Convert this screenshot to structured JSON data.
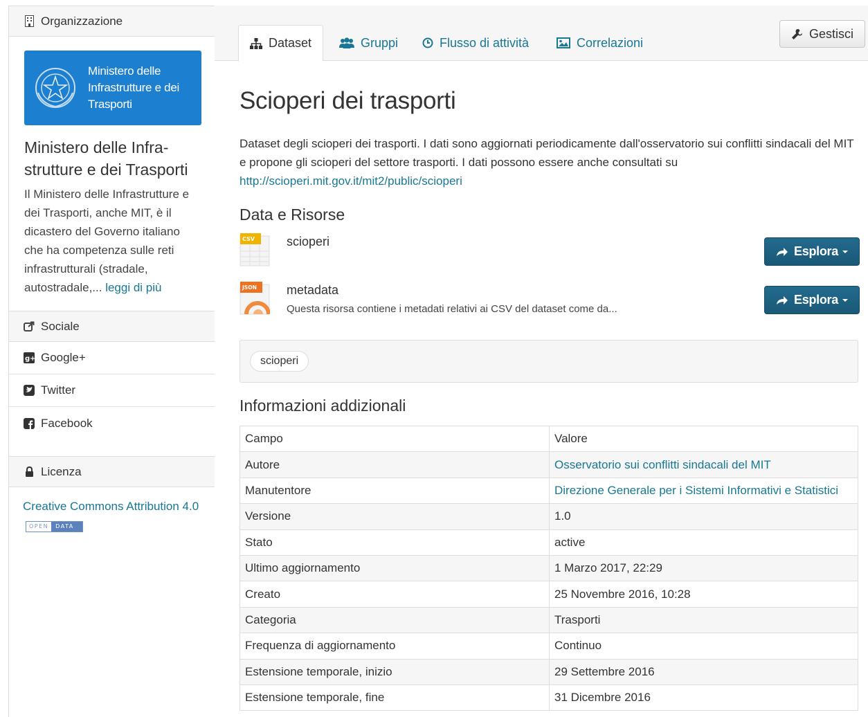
{
  "sidebar": {
    "org_heading": "Organizzazione",
    "logo_text": [
      "Ministero delle",
      "Infrastrutture e dei",
      "Trasporti"
    ],
    "org_title_line1": "Ministero delle Infra-",
    "org_title_line2": "strutture e dei Trasporti",
    "org_description": "Il Ministero delle Infrastrutture e dei Trasporti, anche MIT, è il dicastero del Governo italiano che ha competenza sulle reti infrastrutturali (stradale, autostradale,...",
    "read_more": "leggi di più",
    "social_heading": "Sociale",
    "social_items": [
      {
        "label": "Google+",
        "icon": "google-plus-icon"
      },
      {
        "label": "Twitter",
        "icon": "twitter-icon"
      },
      {
        "label": "Facebook",
        "icon": "facebook-icon"
      }
    ],
    "license_heading": "Licenza",
    "license_link": "Creative Commons Attribution 4.0",
    "badge_open": "OPEN",
    "badge_data": "DATA"
  },
  "tabs": [
    {
      "label": "Dataset",
      "icon": "sitemap-icon",
      "active": true
    },
    {
      "label": "Gruppi",
      "icon": "users-icon",
      "active": false
    },
    {
      "label": "Flusso di attività",
      "icon": "clock-icon",
      "active": false
    },
    {
      "label": "Correlazioni",
      "icon": "picture-icon",
      "active": false
    }
  ],
  "manage_label": "Gestisci",
  "dataset": {
    "title": "Scioperi dei trasporti",
    "description": "Dataset degli scioperi dei trasporti. I dati sono aggiornati periodicamente dall'osservatorio sui conflitti sindacali del MIT e propone gli scioperi del settore trasporti. I dati possono essere anche consultati su",
    "description_link": "http://scioperi.mit.gov.it/mit2/public/scioperi"
  },
  "resources_heading": "Data e Risorse",
  "resources": [
    {
      "name": "scioperi",
      "description": "",
      "format": "CSV",
      "format_color": "#f0b400",
      "action": "Esplora"
    },
    {
      "name": "metadata",
      "description": "Questa risorsa contiene i metadati relativi ai CSV del dataset come da...",
      "format": "JSON",
      "format_color": "#ec7221",
      "action": "Esplora"
    }
  ],
  "tags": [
    "scioperi"
  ],
  "info_heading": "Informazioni addizionali",
  "info_rows": [
    {
      "field": "Campo",
      "value": "Valore",
      "link": false
    },
    {
      "field": "Autore",
      "value": "Osservatorio sui conflitti sindacali del MIT",
      "link": true
    },
    {
      "field": "Manutentore",
      "value": "Direzione Generale per i Sistemi Informativi e Statistici",
      "link": true
    },
    {
      "field": "Versione",
      "value": "1.0",
      "link": false
    },
    {
      "field": "Stato",
      "value": "active",
      "link": false
    },
    {
      "field": "Ultimo aggiornamento",
      "value": "1 Marzo 2017, 22:29",
      "link": false
    },
    {
      "field": "Creato",
      "value": "25 Novembre 2016, 10:28",
      "link": false
    },
    {
      "field": "Categoria",
      "value": "Trasporti",
      "link": false
    },
    {
      "field": "Frequenza di aggiornamento",
      "value": "Continuo",
      "link": false
    },
    {
      "field": "Estensione temporale, inizio",
      "value": "29 Settembre 2016",
      "link": false
    },
    {
      "field": "Estensione temporale, fine",
      "value": "31 Dicembre 2016",
      "link": false
    }
  ],
  "colors": {
    "link": "#187794",
    "logo_bg": "#1d7fd0",
    "button_primary": "#1f6386",
    "panel_bg": "#f6f6f6",
    "border": "#dddddd"
  }
}
